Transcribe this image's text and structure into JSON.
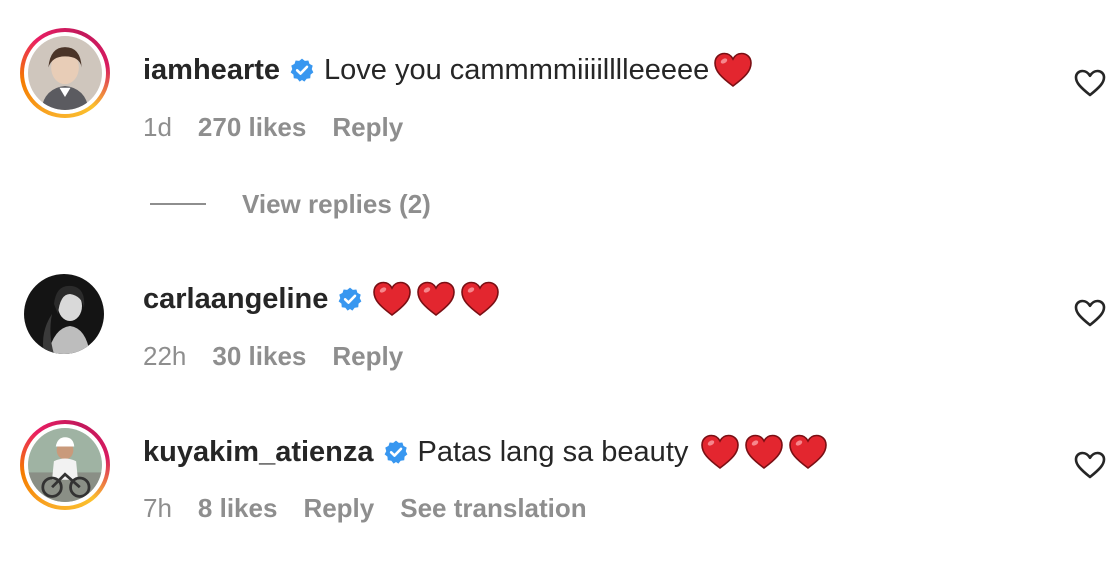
{
  "comments": [
    {
      "username": "iamhearte",
      "verified": true,
      "text": "Love you cammmmiiiilllleeeee",
      "hearts": 1,
      "time": "1d",
      "likes": "270 likes",
      "reply_label": "Reply",
      "has_story_ring": true,
      "view_replies": "View replies (2)"
    },
    {
      "username": "carlaangeline",
      "verified": true,
      "text": "",
      "hearts": 3,
      "time": "22h",
      "likes": "30 likes",
      "reply_label": "Reply",
      "has_story_ring": false
    },
    {
      "username": "kuyakim_atienza",
      "verified": true,
      "text": "Patas lang sa beauty",
      "hearts": 3,
      "time": "7h",
      "likes": "8 likes",
      "reply_label": "Reply",
      "translation_label": "See translation",
      "has_story_ring": true
    }
  ],
  "icons": {
    "verified": "verified-badge-icon",
    "heart_emoji": "red-heart-emoji",
    "like": "heart-outline-icon"
  },
  "colors": {
    "verified_blue": "#3897f0",
    "heart_red": "#e3262f",
    "meta_gray": "#8e8e8e",
    "text_dark": "#262626"
  }
}
